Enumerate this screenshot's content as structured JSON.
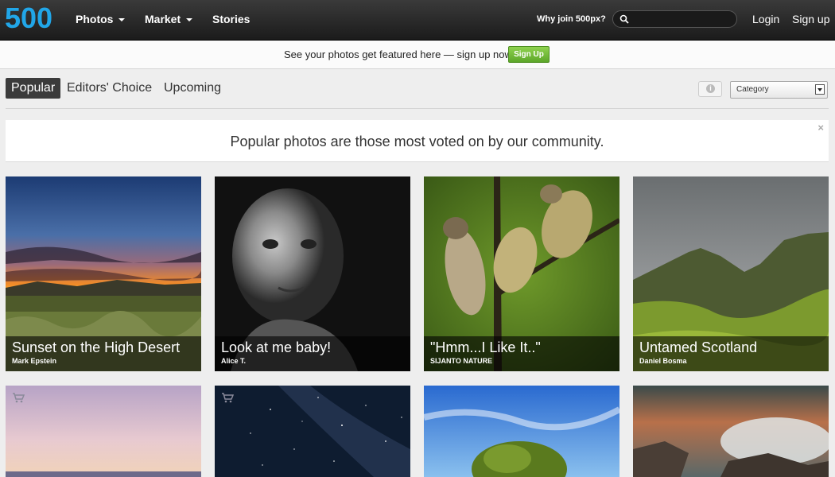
{
  "header": {
    "logo": "500",
    "nav": [
      {
        "label": "Photos",
        "has_menu": true
      },
      {
        "label": "Market",
        "has_menu": true
      },
      {
        "label": "Stories",
        "has_menu": false
      }
    ],
    "why_join": "Why join 500px?",
    "search_placeholder": "",
    "login": "Login",
    "signup": "Sign up"
  },
  "promo": {
    "text": "See your photos get featured here — sign up now.",
    "button": "Sign Up"
  },
  "tabs": [
    {
      "label": "Popular",
      "active": true
    },
    {
      "label": "Editors' Choice",
      "active": false
    },
    {
      "label": "Upcoming",
      "active": false
    }
  ],
  "category_select": {
    "selected": "Category"
  },
  "info_icon": "i",
  "notice": {
    "text": "Popular photos are those most voted on by our community.",
    "close": "×"
  },
  "photos": [
    {
      "title": "Sunset on the High Desert",
      "author": "Mark Epstein"
    },
    {
      "title": "Look at me baby!",
      "author": "Alice T."
    },
    {
      "title": "\"Hmm...I Like It..\"",
      "author": "SIJANTO NATURE"
    },
    {
      "title": "Untamed Scotland",
      "author": "Daniel Bosma"
    }
  ],
  "colors": {
    "brand_blue": "#21a6e8",
    "signup_green": "#6cba36",
    "nav_dark": "#1b1b1b"
  }
}
